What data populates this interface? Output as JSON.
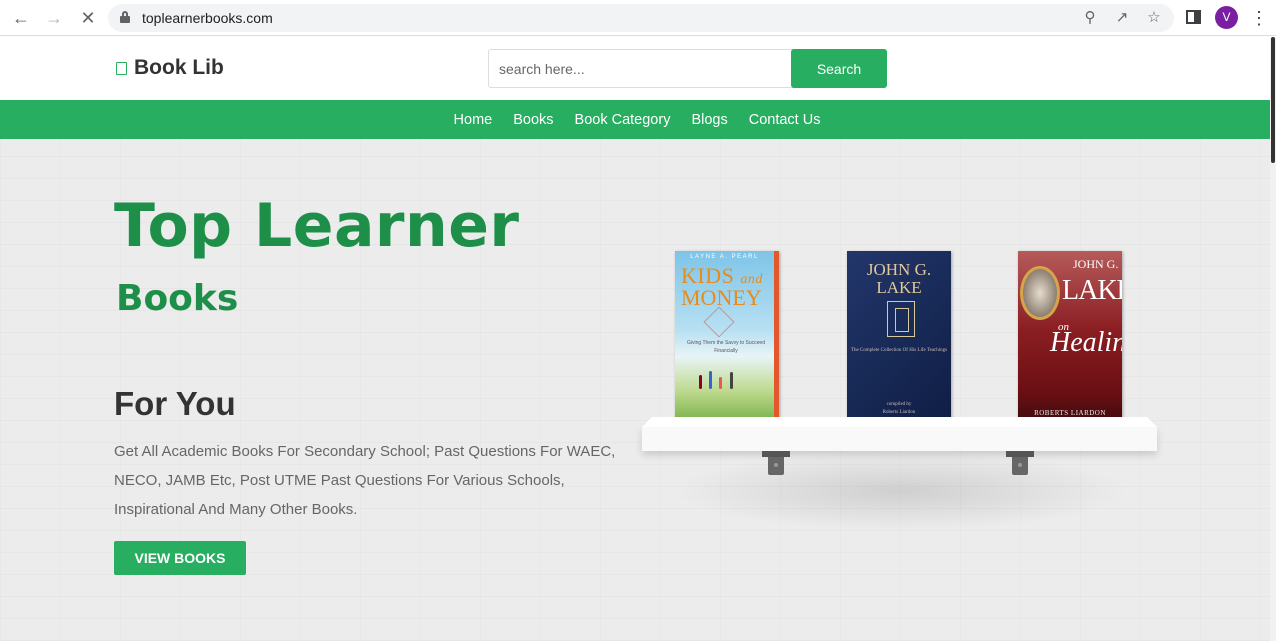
{
  "browser": {
    "url": "toplearnerbooks.com",
    "avatar_letter": "V",
    "back_icon": "back-arrow-icon",
    "forward_icon": "forward-arrow-icon",
    "reload_icon": "stop-loading-icon"
  },
  "header": {
    "logo_text": "Book Lib",
    "search_placeholder": "search here...",
    "search_button": "Search"
  },
  "nav": {
    "items": [
      "Home",
      "Books",
      "Book Category",
      "Blogs",
      "Contact Us"
    ]
  },
  "hero": {
    "title": "Top Learner",
    "subtitle": "Books",
    "for_you": "For You",
    "description": "Get All Academic Books For Secondary School; Past Questions For WAEC, NECO, JAMB Etc, Post UTME Past Questions For Various Schools, Inspirational And Many Other Books.",
    "button": "VIEW BOOKS"
  },
  "books": {
    "b1": {
      "author": "LAYNE A. PEARL",
      "title_a": "KIDS",
      "title_and": "and",
      "title_b": "MONEY",
      "subtitle": "Giving Them the Savvy to Succeed Financially"
    },
    "b2": {
      "title_a": "JOHN G.",
      "title_b": "LAKE",
      "subtitle": "The Complete Collection Of His Life Teachings",
      "compiler": "compiled by",
      "by": "Roberts Liardon"
    },
    "b3": {
      "title_a": "JOHN G.",
      "title_b": "LAKE",
      "on": "on",
      "title_c": "Healing",
      "by": "ROBERTS LIARDON"
    }
  },
  "colors": {
    "brand_green": "#27ae60",
    "hero_green": "#1e8f49"
  }
}
